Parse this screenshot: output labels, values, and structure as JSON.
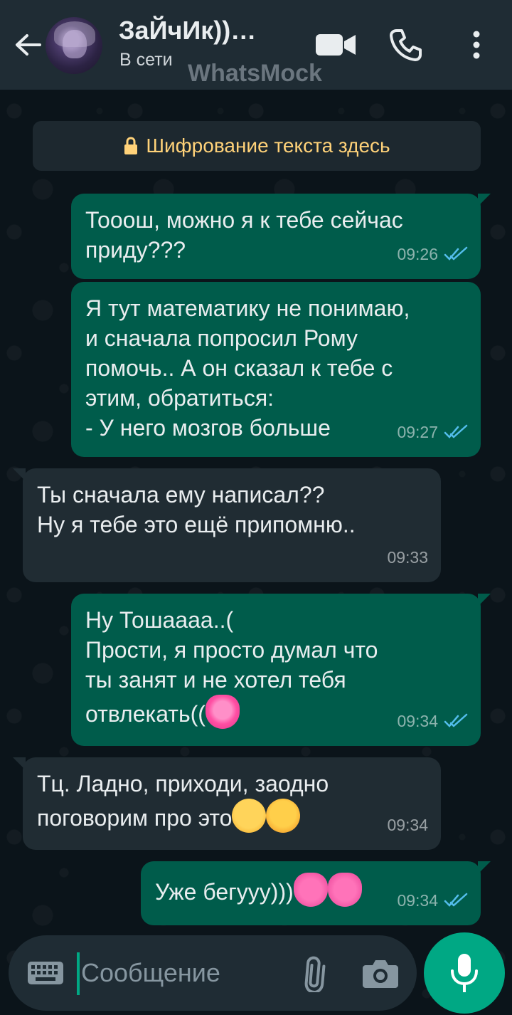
{
  "header": {
    "contact_name": "ЗаЙчИк))…",
    "status": "В сети",
    "watermark": "WhatsMock",
    "icons": [
      "back-arrow-icon",
      "avatar",
      "video-call-icon",
      "phone-icon",
      "more-vert-icon"
    ]
  },
  "encryption_notice": "Шифрование текста здесь",
  "messages": [
    {
      "dir": "out",
      "text": "Тооош, можно я к тебе сейчас\nприду???",
      "time": "09:26",
      "read": true
    },
    {
      "dir": "out",
      "text": "Я тут математику не понимаю,\nи сначала попросил Рому\nпомочь.. А он сказал к тебе с\nэтим, обратиться:\n- У него мозгов больше",
      "time": "09:27",
      "read": true
    },
    {
      "dir": "in",
      "text": "Ты сначала ему написал??\nНу я тебе это ещё припомню..",
      "time": "09:33"
    },
    {
      "dir": "out",
      "text": "Ну Тошаааа..(\nПрости, я просто думал что\nты занят и не хотел тебя\nотвлекать((",
      "emoji": [
        "growing-heart"
      ],
      "time": "09:34",
      "read": true
    },
    {
      "dir": "in",
      "text": "Тц. Ладно, приходи, заодно\nпоговорим про это",
      "emoji": [
        "face-with-steam",
        "angry-face"
      ],
      "time": "09:34"
    },
    {
      "dir": "out",
      "text": "Уже бегууу)))",
      "emoji": [
        "two-hearts",
        "two-hearts"
      ],
      "time": "09:34",
      "read": true
    }
  ],
  "input": {
    "placeholder": "Сообщение"
  },
  "colors": {
    "outgoing_bubble": "#005c4b",
    "incoming_bubble": "#202c33",
    "header": "#1f2c34",
    "accent": "#00a884",
    "read_ticks": "#53bdeb",
    "encryption_text": "#ffd279"
  }
}
